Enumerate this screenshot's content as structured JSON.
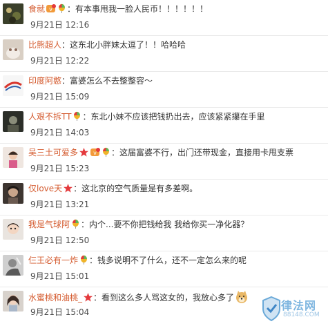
{
  "colors": {
    "username": "#d45a2e",
    "text": "#333333",
    "time": "#4a4a4a",
    "star": "#e4393c",
    "divider": "#eaeaea"
  },
  "comments": [
    {
      "user": "食就",
      "badges": [
        "vip-icon",
        "balloon-icon"
      ],
      "text": "：有本事甩我一脸人民币！！！！！！",
      "time": "9月21日 12:16"
    },
    {
      "user": "比熊超人",
      "badges": [],
      "text": "：这东北小胖妹太逗了！！哈哈哈",
      "time": "9月21日 12:22"
    },
    {
      "user": "印度阿憨",
      "badges": [],
      "text": "：富婆怎么不去整整容～",
      "time": "9月21日 15:09"
    },
    {
      "user": "人艰不拆TT",
      "badges": [
        "balloon-icon"
      ],
      "text": "：东北小妹不应该把钱扔出去，应该紧紧攥在手里",
      "time": "9月21日 14:03"
    },
    {
      "user": "吴三土可爱多",
      "badges": [
        "star-icon",
        "vip-icon",
        "balloon-icon"
      ],
      "text": "：这届富婆不行，出门还带现金，直接用卡甩支票",
      "time": "9月21日 15:23"
    },
    {
      "user": "仅love天",
      "badges": [
        "star-icon"
      ],
      "text": "：这北京的空气质量是有多差啊。",
      "time": "9月21日 13:21"
    },
    {
      "user": "我是气球阿",
      "badges": [
        "balloon-icon"
      ],
      "text": "：内个...要不你把钱给我 我给你买一净化器？",
      "time": "9月21日 12:50"
    },
    {
      "user": "仨王必有一炸",
      "badges": [
        "balloon-icon"
      ],
      "text": "：钱多说明不了什么，还不一定怎么来的呢",
      "time": "9月21日 15:01"
    },
    {
      "user": "水蜜桃和油桃_",
      "badges": [
        "star-icon"
      ],
      "text": "：看到这么多人骂这女的，我放心多了",
      "emoji": "doge-emoji-icon",
      "time": "9月21日 15:04"
    }
  ],
  "watermark": {
    "text": "律法网",
    "sub": "88148.COM"
  }
}
